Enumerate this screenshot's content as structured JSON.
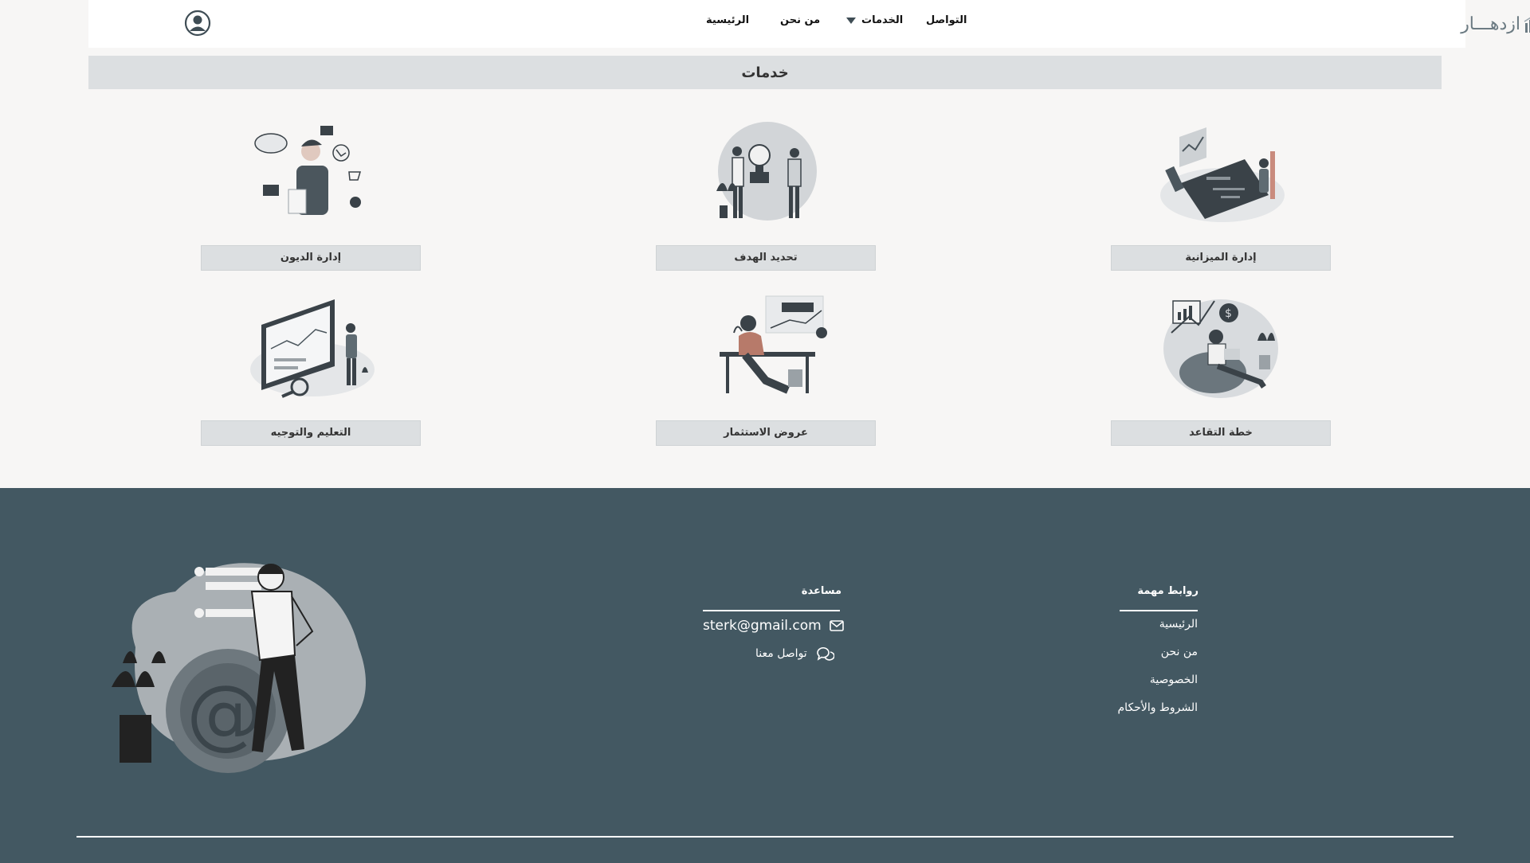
{
  "header": {
    "logo_text": "ازدهـــار",
    "nav": {
      "home": "الرئيسية",
      "about": "من نحن",
      "services": "الخدمات",
      "contact": "التواصل"
    },
    "user_icon": "user-circle-icon"
  },
  "page_title": "خدمات",
  "services": [
    {
      "label": "إدارة الميزانية",
      "icon": "budget-illustration"
    },
    {
      "label": "تحديد الهدف",
      "icon": "goal-illustration"
    },
    {
      "label": "إدارة الديون",
      "icon": "debt-illustration"
    },
    {
      "label": "خطة التقاعد",
      "icon": "retirement-illustration"
    },
    {
      "label": "عروض الاستثمار",
      "icon": "investment-illustration"
    },
    {
      "label": "التعليم والتوجيه",
      "icon": "education-illustration"
    }
  ],
  "footer": {
    "links_title": "روابط مهمة",
    "links": [
      "الرئيسية",
      "من نحن",
      "الخصوصية",
      "الشروط والأحكام"
    ],
    "help_title": "مساعدة",
    "email": "sterk@gmail.com",
    "contact_us": "تواصل معنا",
    "colors": {
      "background": "#435862",
      "text": "#ffffff"
    }
  },
  "colors": {
    "page_bg": "#f7f6f5",
    "label_bg": "#dcdfe1",
    "accent": "#435862"
  }
}
